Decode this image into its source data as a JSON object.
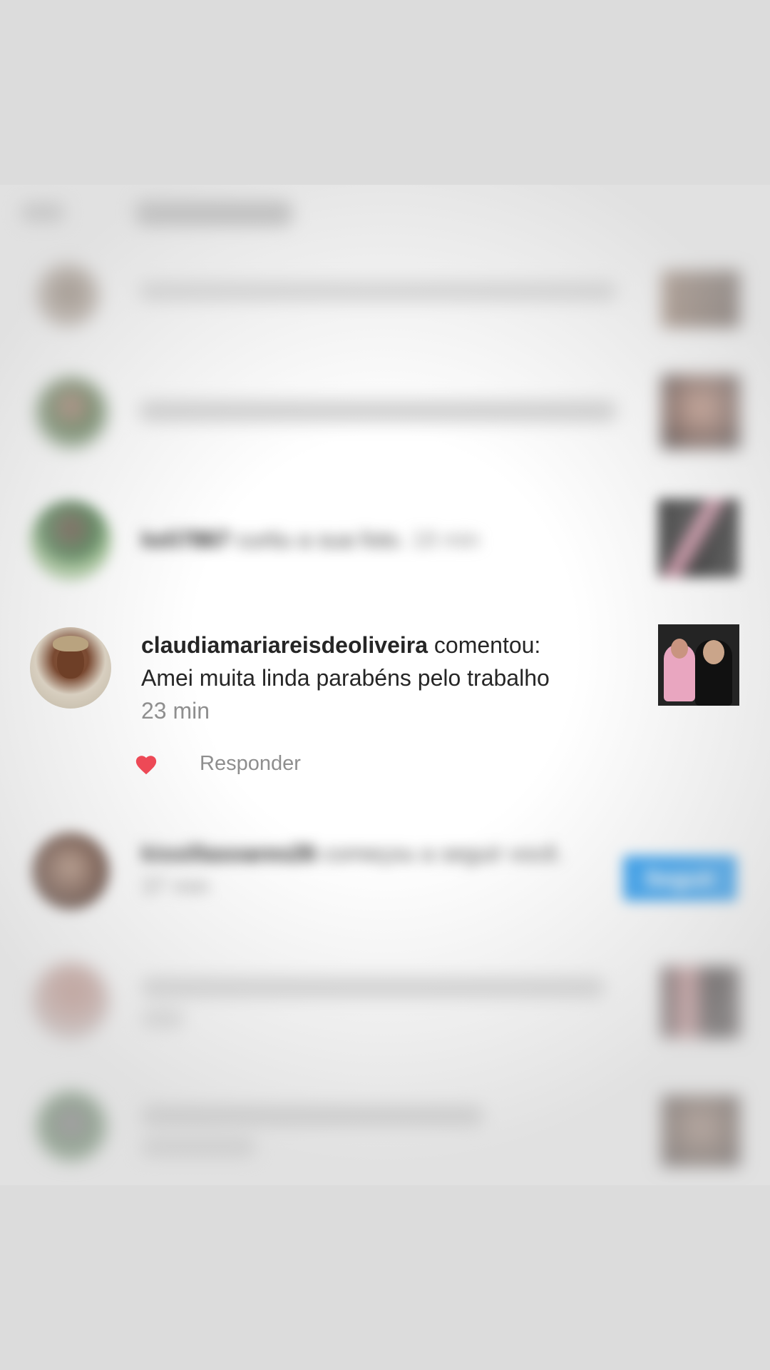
{
  "header": {
    "title": ""
  },
  "notifications": [
    {
      "username": "",
      "action": "",
      "time": ""
    },
    {
      "username": "",
      "action": "",
      "time": ""
    },
    {
      "username": "keli7867",
      "action": "curtiu a sua foto.",
      "time": "18 min"
    },
    {
      "username": "claudiamariareisdeoliveira",
      "action": "comentou:",
      "comment": "Amei muita linda parabéns pelo trabalho",
      "time": "23 min",
      "reply_label": "Responder"
    },
    {
      "username": "kissillasoares26",
      "action": "começou a seguir você.",
      "time": "37 min",
      "follow_label": "Seguir"
    },
    {
      "username": "",
      "action": "",
      "time": ""
    },
    {
      "username": "",
      "action": "",
      "time": ""
    }
  ],
  "colors": {
    "accent": "#1b95f0",
    "heart": "#ed4956",
    "username": "#262626",
    "muted": "#8e8e8e"
  },
  "icons": {
    "like": "heart-icon"
  }
}
